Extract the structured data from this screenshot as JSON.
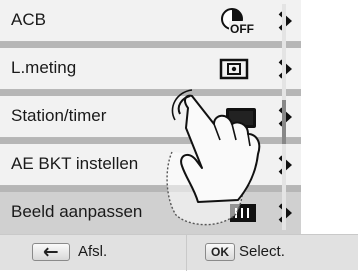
{
  "menu": {
    "items": [
      {
        "label": "ACB",
        "icon": "acb-off-icon"
      },
      {
        "label": "L.meting",
        "icon": "metering-icon"
      },
      {
        "label": "Station/timer",
        "icon": "single-shot-icon"
      },
      {
        "label": "AE BKT instellen",
        "icon": "ae-bracket-icon"
      },
      {
        "label": "Beeld aanpassen",
        "icon": "image-adjust-icon"
      }
    ],
    "acb_off_text": "OFF"
  },
  "bottom_bar": {
    "back_label": "Afsl.",
    "select_key": "OK",
    "select_label": "Select."
  },
  "colors": {
    "row_bg": "#f2f2f2",
    "selected_row_bg": "#d0d0d0",
    "icon_color": "#111111"
  }
}
